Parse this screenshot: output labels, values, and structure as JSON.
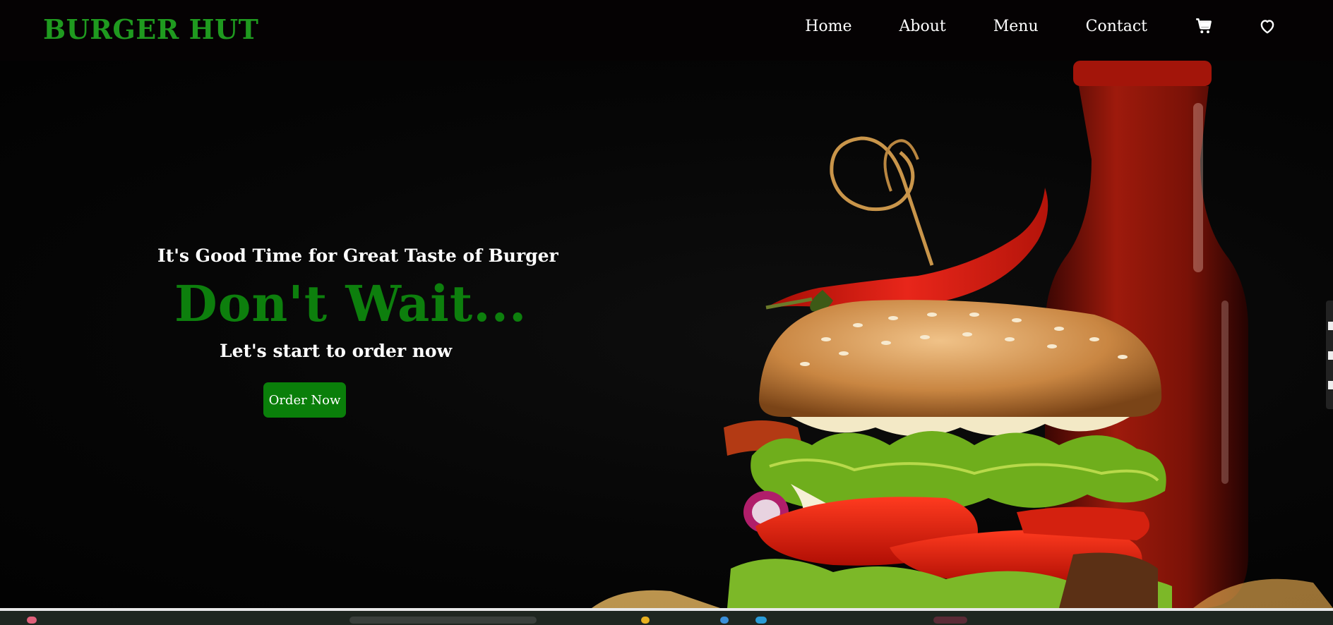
{
  "brand": {
    "logo": "BURGER HUT"
  },
  "nav": {
    "links": [
      "Home",
      "About",
      "Menu",
      "Contact"
    ],
    "icons": [
      "cart-icon",
      "heart-icon"
    ]
  },
  "hero": {
    "tagline": "It's Good Time for Great Taste of Burger",
    "headline": "Don't Wait...",
    "subline": "Let's start to order now",
    "cta": "Order Now"
  },
  "colors": {
    "accent_green": "#1f9a1f",
    "headline_green": "#0d7f0d",
    "button_green": "#0a7f0a",
    "background": "#000000"
  }
}
